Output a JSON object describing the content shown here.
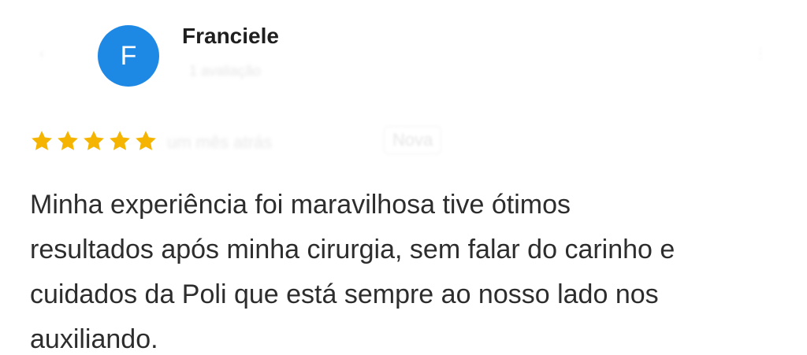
{
  "reviewer": {
    "initial": "F",
    "name": "Franciele",
    "avatar_color": "#1e88e5",
    "subline": "1 avaliação"
  },
  "rating": {
    "stars": 5,
    "max": 5,
    "star_color": "#f4b400"
  },
  "meta": {
    "time": "um mês atrás",
    "badge": "Nova"
  },
  "review": {
    "line1": "Minha experiência foi maravilhosa tive ótimos",
    "line2": "resultados após minha cirurgia, sem falar do carinho e",
    "line3": "cuidados da Poli que está sempre ao nosso lado nos",
    "line4": "auxiliando."
  }
}
